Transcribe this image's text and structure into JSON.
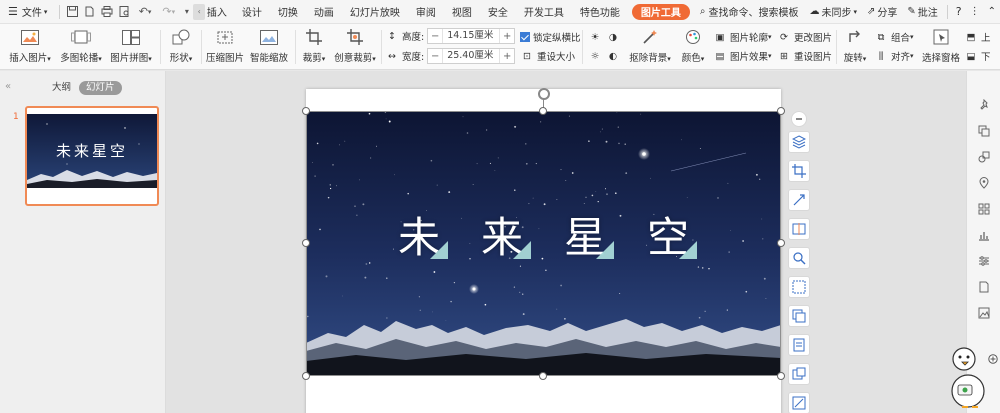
{
  "menubar": {
    "file_label": "文件",
    "tabs": [
      "插入",
      "设计",
      "切换",
      "动画",
      "幻灯片放映",
      "审阅",
      "视图",
      "安全",
      "开发工具",
      "特色功能",
      "图片工具"
    ],
    "active_tab": "图片工具",
    "search_placeholder": "查找命令、搜索模板",
    "sync_label": "未同步",
    "share_label": "分享",
    "comment_label": "批注",
    "help_label": "?"
  },
  "ribbon": {
    "insert_picture": "插入图片",
    "multi_outline": "多图轮播",
    "picture_collage": "图片拼图",
    "shape": "形状",
    "compress": "压缩图片",
    "smart_scale": "智能缩放",
    "crop": "裁剪",
    "creative_crop": "创意裁剪",
    "height_label": "高度:",
    "height_value": "14.15厘米",
    "width_label": "宽度:",
    "width_value": "25.40厘米",
    "lock_ratio": "锁定纵横比",
    "reset_size": "重设大小",
    "remove_bg": "抠除背景",
    "color": "颜色",
    "picture_outline": "图片轮廓",
    "picture_effect": "图片效果",
    "change_picture": "更改图片",
    "reset_picture": "重设图片",
    "rotate": "旋转",
    "group": "组合",
    "align": "对齐",
    "selection_pane": "选择窗格",
    "bring_up": "上",
    "send_down": "下"
  },
  "leftpanel": {
    "tab_outline": "大纲",
    "tab_slides": "幻灯片",
    "slide_number": "1",
    "thumb_title": "未来星空"
  },
  "slide": {
    "title_chars": [
      "未",
      "来",
      "星",
      "空"
    ]
  },
  "colors": {
    "accent": "#f06a35",
    "sky_top": "#0f1838",
    "sky_bottom": "#2a4478",
    "triangle": "#a9d9d8"
  }
}
